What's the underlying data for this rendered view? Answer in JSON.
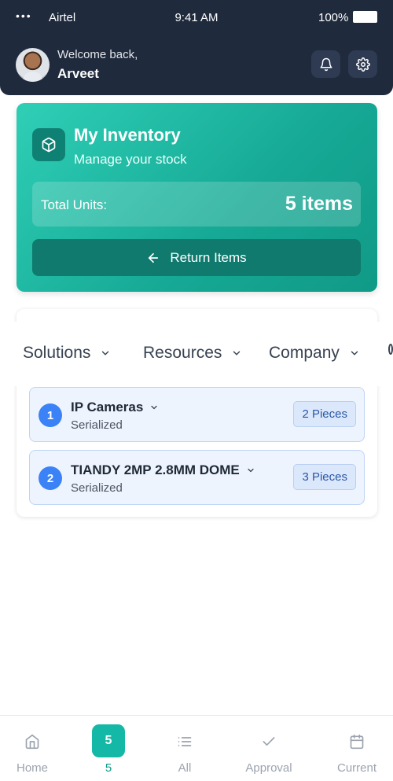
{
  "status_bar": {
    "carrier": "Airtel",
    "time": "9:41 AM",
    "battery": "100%"
  },
  "header": {
    "welcome": "Welcome back,",
    "user_name": "Arveet"
  },
  "inventory": {
    "title": "My Inventory",
    "subtitle": "Manage your stock",
    "total_label": "Total Units:",
    "total_value": "5 items",
    "return_label": "Return Items"
  },
  "nav_menu": {
    "items": [
      {
        "label": "Solutions"
      },
      {
        "label": "Resources"
      },
      {
        "label": "Company"
      }
    ]
  },
  "products": [
    {
      "index": "1",
      "name": "IP Cameras",
      "type": "Serialized",
      "quantity": "2 Pieces"
    },
    {
      "index": "2",
      "name": "TIANDY 2MP 2.8MM DOME",
      "type": "Serialized",
      "quantity": "3 Pieces"
    }
  ],
  "tabbar": {
    "tabs": [
      {
        "label": "Home",
        "icon": "home-icon"
      },
      {
        "label": "5",
        "badge": "5",
        "icon": "active-count-badge"
      },
      {
        "label": "All",
        "icon": "list-icon"
      },
      {
        "label": "Approval",
        "icon": "check-icon"
      },
      {
        "label": "Current",
        "icon": "calendar-icon"
      }
    ]
  },
  "colors": {
    "header_bg": "#1f2a3d",
    "accent": "#14b8a6",
    "row_bg": "#eef4fd",
    "badge_blue": "#3b82f6"
  }
}
